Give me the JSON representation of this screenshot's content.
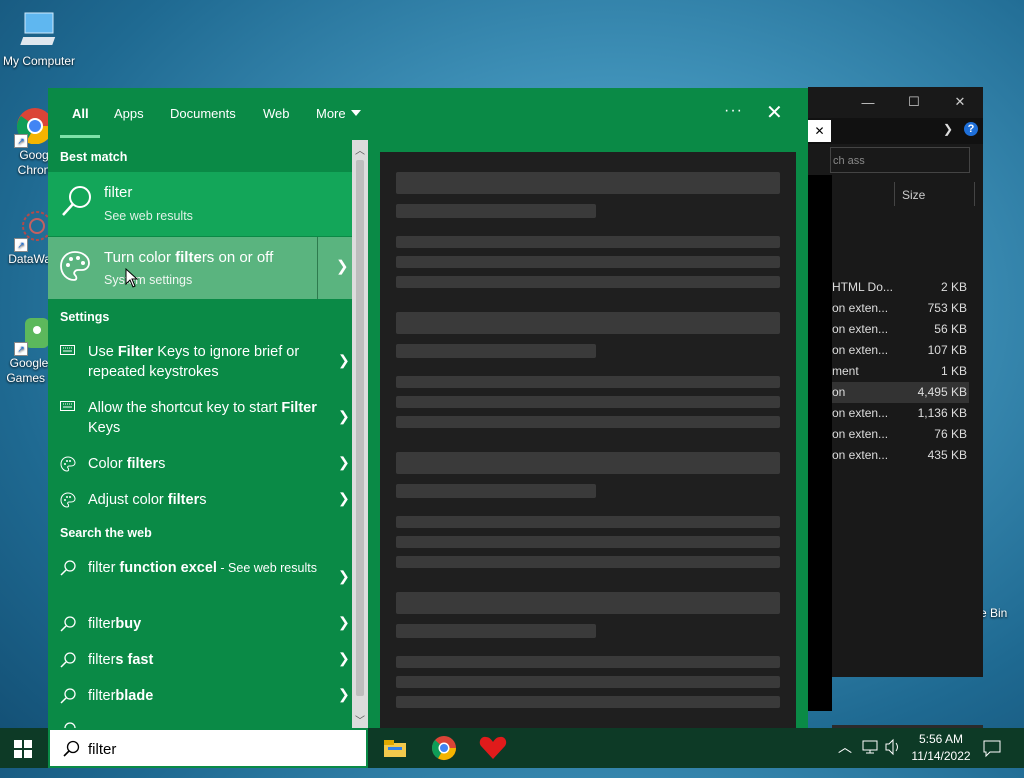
{
  "desktop": {
    "icons": [
      {
        "label": "My Computer"
      },
      {
        "label": "Goog Chron"
      },
      {
        "label": "DataWag"
      },
      {
        "label": "Google Games I"
      }
    ],
    "recycle_label": "e Bin"
  },
  "explorer": {
    "search_placeholder": "ch ass",
    "col_size": "Size",
    "rows": [
      {
        "type": "HTML Do...",
        "size": "2 KB"
      },
      {
        "type": "on exten...",
        "size": "753 KB"
      },
      {
        "type": "on exten...",
        "size": "56 KB"
      },
      {
        "type": "on exten...",
        "size": "107 KB"
      },
      {
        "type": "ment",
        "size": "1 KB"
      },
      {
        "type": "on",
        "size": "4,495 KB"
      },
      {
        "type": "on exten...",
        "size": "1,136 KB"
      },
      {
        "type": "on exten...",
        "size": "76 KB"
      },
      {
        "type": "on exten...",
        "size": "435 KB"
      }
    ]
  },
  "search": {
    "tabs": [
      "All",
      "Apps",
      "Documents",
      "Web",
      "More"
    ],
    "best_match_title": "Best match",
    "best": {
      "title": "filter",
      "subtitle": "See web results"
    },
    "hover": {
      "title_pre": "Turn color ",
      "title_bold": "filte",
      "title_post": "rs on or off",
      "subtitle": "System settings"
    },
    "settings_title": "Settings",
    "settings": [
      {
        "pre": "Use ",
        "bold": "Filter",
        "post": " Keys to ignore brief or repeated keystrokes"
      },
      {
        "pre": "Allow the shortcut key to start ",
        "bold": "Filter",
        "post": " Keys"
      },
      {
        "pre": "Color ",
        "bold": "filter",
        "post": "s"
      },
      {
        "pre": "Adjust color ",
        "bold": "filter",
        "post": "s"
      }
    ],
    "web_title": "Search the web",
    "web": [
      {
        "pre": "filter ",
        "bold": "function excel",
        "post": " - See web results"
      },
      {
        "pre": "filter",
        "bold": "buy",
        "post": ""
      },
      {
        "pre": "filter",
        "bold": "s fast",
        "post": ""
      },
      {
        "pre": "filter",
        "bold": "blade",
        "post": ""
      }
    ],
    "query": "filter"
  },
  "clock": {
    "time": "5:56 AM",
    "date": "11/14/2022"
  }
}
